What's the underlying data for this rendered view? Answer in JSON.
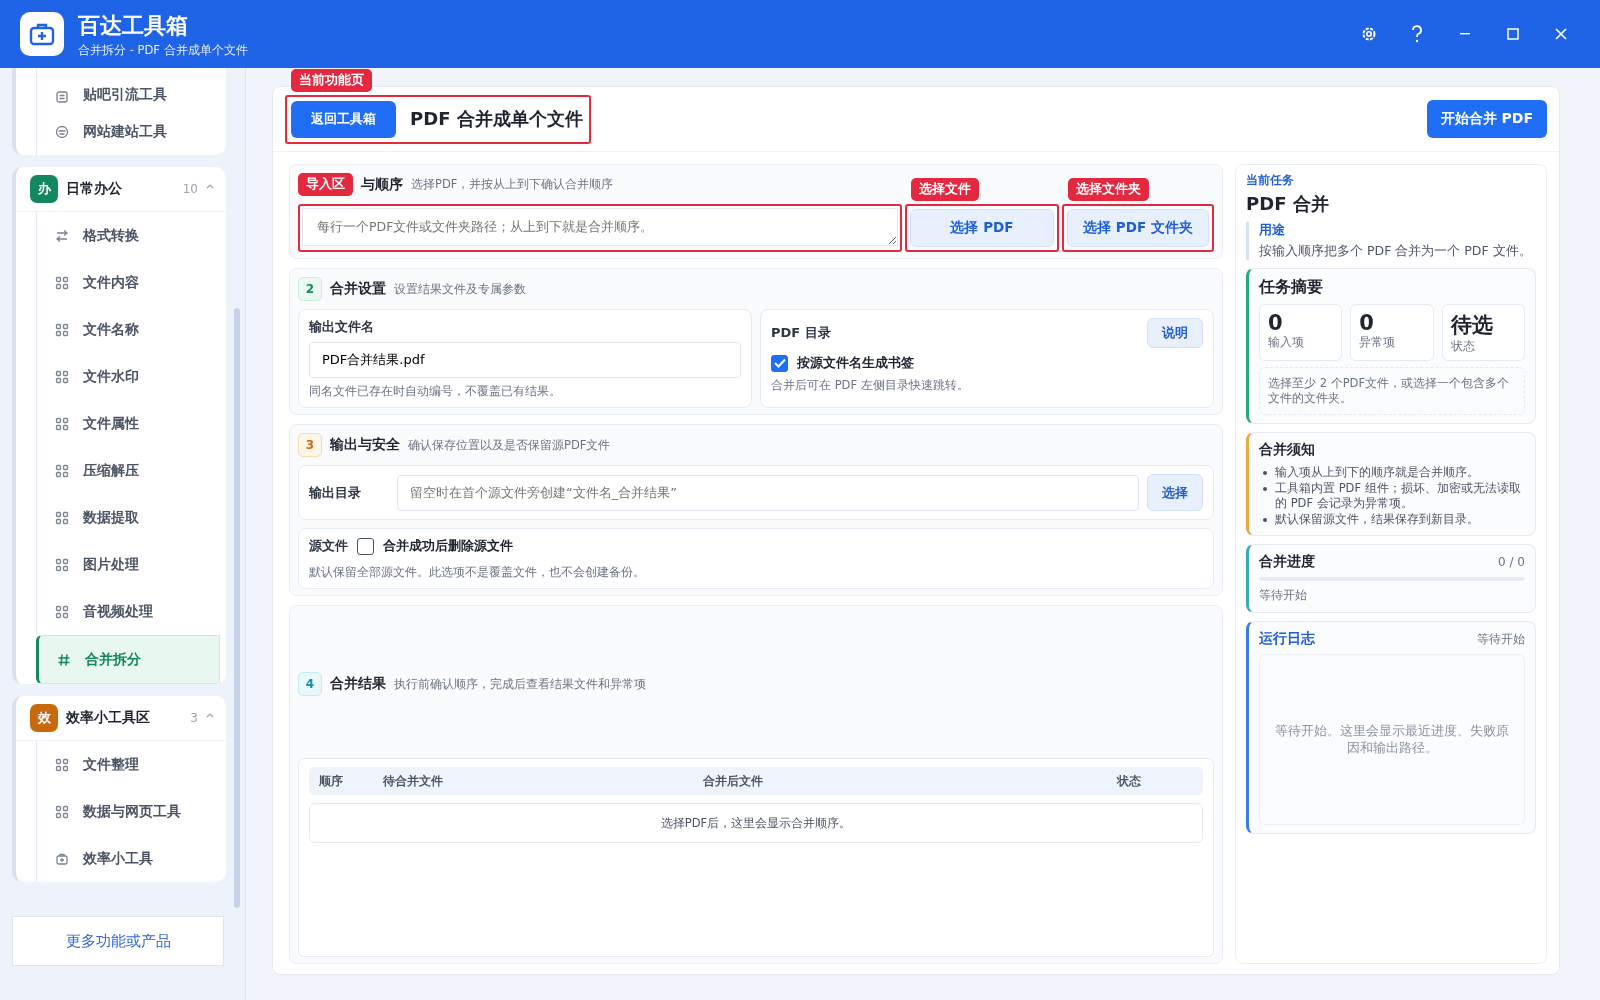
{
  "app": {
    "title": "百达工具箱",
    "subtitle": "合并拆分 - PDF 合并成单个文件"
  },
  "sidebar": {
    "groups": [
      {
        "items": [
          {
            "label": "贴吧引流工具",
            "kind": "page",
            "selected": false
          },
          {
            "label": "网站建站工具",
            "kind": "site",
            "selected": false
          }
        ]
      },
      {
        "badge": "办",
        "color": "#13875f",
        "name": "日常办公",
        "count": "10",
        "expanded": true,
        "items": [
          {
            "label": "格式转换",
            "kind": "swap",
            "selected": false
          },
          {
            "label": "文件内容",
            "kind": "grid",
            "selected": false
          },
          {
            "label": "文件名称",
            "kind": "grid",
            "selected": false
          },
          {
            "label": "文件水印",
            "kind": "grid",
            "selected": false
          },
          {
            "label": "文件属性",
            "kind": "grid",
            "selected": false
          },
          {
            "label": "压缩解压",
            "kind": "grid",
            "selected": false
          },
          {
            "label": "数据提取",
            "kind": "grid",
            "selected": false
          },
          {
            "label": "图片处理",
            "kind": "grid",
            "selected": false
          },
          {
            "label": "音视频处理",
            "kind": "grid",
            "selected": false
          },
          {
            "label": "合并拆分",
            "kind": "hash",
            "selected": true
          }
        ]
      },
      {
        "badge": "效",
        "color": "#c8690f",
        "name": "效率小工具区",
        "count": "3",
        "expanded": true,
        "items": [
          {
            "label": "文件整理",
            "kind": "grid",
            "selected": false
          },
          {
            "label": "数据与网页工具",
            "kind": "grid",
            "selected": false
          },
          {
            "label": "效率小工具",
            "kind": "kit",
            "selected": false
          }
        ]
      }
    ],
    "more_link": "更多功能或产品"
  },
  "topbar": {
    "back_button": "返回工具箱",
    "title": "PDF 合并成单个文件",
    "start_button": "开始合并 PDF",
    "annotation": "当前功能页"
  },
  "section_import": {
    "title": "与顺序",
    "hint": "选择PDF，并按从上到下确认合并顺序",
    "annotation": "导入区",
    "placeholder": "每行一个PDF文件或文件夹路径；从上到下就是合并顺序。",
    "file_button": "选择 PDF",
    "file_annotation": "选择文件",
    "folder_button": "选择 PDF 文件夹",
    "folder_annotation": "选择文件夹"
  },
  "section_settings": {
    "number": "2",
    "title": "合并设置",
    "hint": "设置结果文件及专属参数",
    "filename_label": "输出文件名",
    "filename_value": "PDF合并结果.pdf",
    "filename_note": "同名文件已存在时自动编号，不覆盖已有结果。",
    "toc_label": "PDF 目录",
    "toc_help": "说明",
    "bookmark_label": "按源文件名生成书签",
    "bookmark_checked": true,
    "toc_note": "合并后可在 PDF 左侧目录快速跳转。"
  },
  "section_output": {
    "number": "3",
    "title": "输出与安全",
    "hint": "确认保存位置以及是否保留源PDF文件",
    "dir_label": "输出目录",
    "dir_placeholder": "留空时在首个源文件旁创建“文件名_合并结果”",
    "dir_button": "选择",
    "source_label": "源文件",
    "delete_label": "合并成功后删除源文件",
    "delete_checked": false,
    "source_note": "默认保留全部源文件。此选项不是覆盖文件，也不会创建备份。"
  },
  "section_result": {
    "number": "4",
    "title": "合并结果",
    "hint": "执行前确认顺序，完成后查看结果文件和异常项",
    "columns": [
      "顺序",
      "待合并文件",
      "合并后文件",
      "状态"
    ],
    "empty": "选择PDF后，这里会显示合并顺序。"
  },
  "task_panel": {
    "eyebrow": "当前任务",
    "title": "PDF 合并",
    "purpose_label": "用途",
    "purpose": "按输入顺序把多个 PDF 合并为一个 PDF 文件。",
    "summary": {
      "title": "任务摘要",
      "stats": [
        {
          "value": "0",
          "label": "输入项"
        },
        {
          "value": "0",
          "label": "异常项"
        },
        {
          "value": "待选",
          "label": "状态"
        }
      ],
      "note": "选择至少 2 个PDF文件，或选择一个包含多个文件的文件夹。"
    },
    "notice": {
      "title": "合并须知",
      "items": [
        "输入项从上到下的顺序就是合并顺序。",
        "工具箱内置 PDF 组件；损坏、加密或无法读取的 PDF 会记录为异常项。",
        "默认保留源文件，结果保存到新目录。"
      ]
    },
    "progress": {
      "title": "合并进度",
      "count": "0 / 0",
      "level": 0,
      "status": "等待开始"
    },
    "log": {
      "title": "运行日志",
      "status": "等待开始",
      "message": "等待开始。这里会显示最近进度、失败原因和输出路径。"
    }
  }
}
